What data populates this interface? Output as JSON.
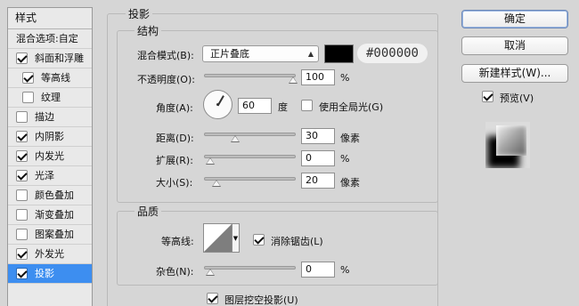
{
  "style_list": {
    "header": "样式",
    "blend_options": "混合选项:自定",
    "items": [
      {
        "label": "斜面和浮雕",
        "checked": true,
        "indent": false
      },
      {
        "label": "等高线",
        "checked": true,
        "indent": true
      },
      {
        "label": "纹理",
        "checked": false,
        "indent": true
      },
      {
        "label": "描边",
        "checked": false,
        "indent": false
      },
      {
        "label": "内阴影",
        "checked": true,
        "indent": false
      },
      {
        "label": "内发光",
        "checked": true,
        "indent": false
      },
      {
        "label": "光泽",
        "checked": true,
        "indent": false
      },
      {
        "label": "颜色叠加",
        "checked": false,
        "indent": false
      },
      {
        "label": "渐变叠加",
        "checked": false,
        "indent": false
      },
      {
        "label": "图案叠加",
        "checked": false,
        "indent": false
      },
      {
        "label": "外发光",
        "checked": true,
        "indent": false
      },
      {
        "label": "投影",
        "checked": true,
        "indent": false,
        "selected": true
      }
    ]
  },
  "drop_shadow": {
    "title": "投影",
    "structure": {
      "title": "结构",
      "blend_mode_label": "混合模式(B):",
      "blend_mode_value": "正片叠底",
      "color_swatch": "#000000",
      "color_hex": "#000000",
      "opacity_label": "不透明度(O):",
      "opacity_value": "100",
      "opacity_unit": "%",
      "opacity_fraction": 1.0,
      "angle_label": "角度(A):",
      "angle_value": "60",
      "angle_unit": "度",
      "global_light_label": "使用全局光(G)",
      "global_light_checked": false,
      "distance_label": "距离(D):",
      "distance_value": "30",
      "distance_unit": "像素",
      "distance_fraction": 0.3,
      "spread_label": "扩展(R):",
      "spread_value": "0",
      "spread_unit": "%",
      "spread_fraction": 0.0,
      "size_label": "大小(S):",
      "size_value": "20",
      "size_unit": "像素",
      "size_fraction": 0.08
    },
    "quality": {
      "title": "品质",
      "contour_label": "等高线:",
      "anti_alias_label": "消除锯齿(L)",
      "anti_alias_checked": true,
      "noise_label": "杂色(N):",
      "noise_value": "0",
      "noise_unit": "%",
      "noise_fraction": 0.0
    },
    "knockout_label": "图层挖空投影(U)",
    "knockout_checked": true
  },
  "buttons": {
    "ok": "确定",
    "cancel": "取消",
    "new_style": "新建样式(W)...",
    "preview_label": "预览(V)",
    "preview_checked": true
  }
}
